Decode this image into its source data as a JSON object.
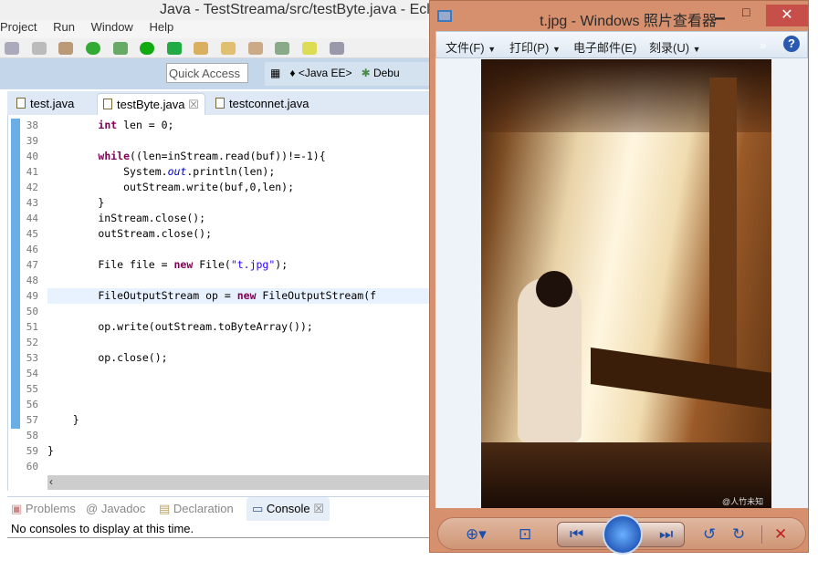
{
  "eclipse": {
    "title": "Java - TestStreama/src/testByte.java - Ecl",
    "menu": [
      "Project",
      "Run",
      "Window",
      "Help"
    ],
    "quick_access": "Quick Access",
    "perspectives": [
      "<Java EE>",
      "Debu"
    ],
    "editor_tabs": [
      {
        "label": "test.java",
        "active": false
      },
      {
        "label": "testByte.java",
        "active": true
      },
      {
        "label": "testconnet.java",
        "active": false
      }
    ],
    "code_lines": [
      {
        "n": "38",
        "html": "        <span class='kw'>int</span> len = 0;"
      },
      {
        "n": "39",
        "html": ""
      },
      {
        "n": "40",
        "html": "        <span class='kw'>while</span>((len=inStream.read(buf))!=-1){"
      },
      {
        "n": "41",
        "html": "            System.<span class='fld'><i>out</i></span>.println(len);"
      },
      {
        "n": "42",
        "html": "            outStream.write(buf,0,len);"
      },
      {
        "n": "43",
        "html": "        }"
      },
      {
        "n": "44",
        "html": "        inStream.close();"
      },
      {
        "n": "45",
        "html": "        outStream.close();"
      },
      {
        "n": "46",
        "html": ""
      },
      {
        "n": "47",
        "html": "        File file = <span class='kw'>new</span> File(<span class='str'>\"t.jpg\"</span>);"
      },
      {
        "n": "48",
        "html": ""
      },
      {
        "n": "49",
        "html": "        FileOutputStream op = <span class='kw'>new</span> FileOutputStream(f"
      },
      {
        "n": "50",
        "html": ""
      },
      {
        "n": "51",
        "html": "        op.write(outStream.toByteArray());"
      },
      {
        "n": "52",
        "html": ""
      },
      {
        "n": "53",
        "html": "        op.close();"
      },
      {
        "n": "54",
        "html": ""
      },
      {
        "n": "55",
        "html": ""
      },
      {
        "n": "56",
        "html": ""
      },
      {
        "n": "57",
        "html": "    }"
      },
      {
        "n": "58",
        "html": ""
      },
      {
        "n": "59",
        "html": "}"
      },
      {
        "n": "60",
        "html": ""
      }
    ],
    "bottom_tabs": [
      {
        "label": "Problems",
        "active": false
      },
      {
        "label": "Javadoc",
        "active": false
      },
      {
        "label": "Declaration",
        "active": false
      },
      {
        "label": "Console",
        "active": true
      }
    ],
    "console_message": "No consoles to display at this time."
  },
  "viewer": {
    "title": "t.jpg - Windows 照片查看器",
    "menu": [
      "文件(F)",
      "打印(P)",
      "电子邮件(E)",
      "刻录(U)"
    ],
    "watermark": "@人竹未知事",
    "accent": "#1a4fb0",
    "close_color": "#c74f4a"
  }
}
